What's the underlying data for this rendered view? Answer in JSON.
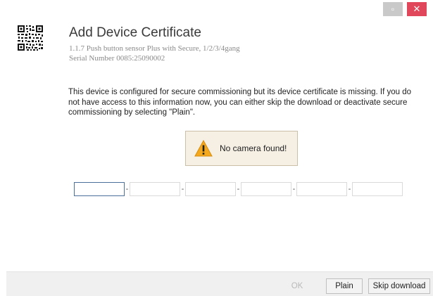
{
  "window": {
    "minimize_glyph": "▫",
    "close_glyph": "✕",
    "accent_close": "#e0475a"
  },
  "header": {
    "title": "Add Device Certificate",
    "device": "1.1.7 Push button sensor Plus with Secure, 1/2/3/4gang",
    "serial": "Serial Number 0085:25090002"
  },
  "message": "This device is configured for secure commissioning but its device certificate is missing. If you do not have access to this information now, you can either skip the download or deactivate secure commissioning by selecting \"Plain\".",
  "warning": {
    "text": "No camera found!",
    "icon": "warning-triangle-icon"
  },
  "certificate_fields": {
    "separator": "-",
    "values": [
      "",
      "",
      "",
      "",
      "",
      ""
    ]
  },
  "footer": {
    "ok_label": "OK",
    "plain_label": "Plain",
    "skip_label": "Skip download"
  }
}
